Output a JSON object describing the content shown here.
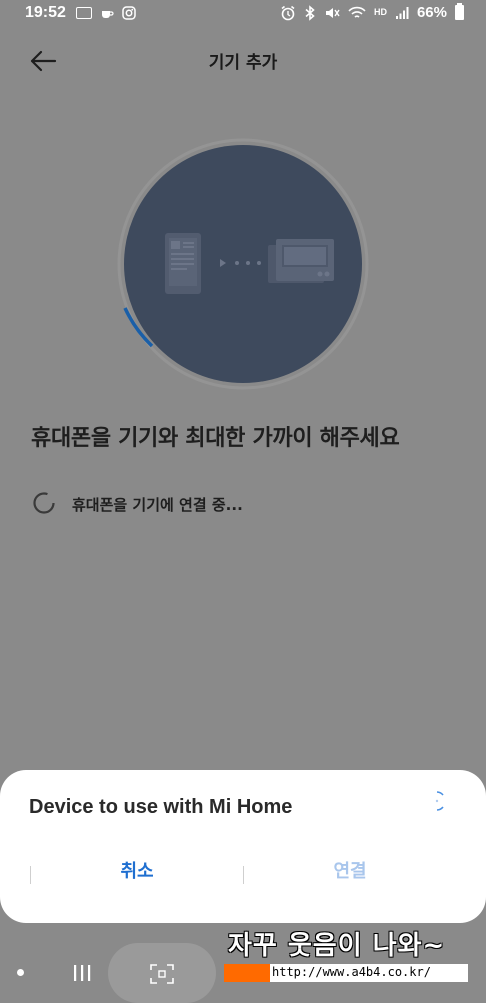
{
  "status_bar": {
    "time": "19:52",
    "battery": "66%",
    "hd_label": "HD"
  },
  "header": {
    "title": "기기 추가",
    "back_icon": "arrow-left-icon"
  },
  "main": {
    "headline": "휴대폰을 기기와 최대한 가까이 해주세요",
    "progress_text": "휴대폰을 기기에 연결 중..."
  },
  "dialog": {
    "title": "Device to use with Mi Home",
    "cancel_label": "취소",
    "connect_label": "연결",
    "colors": {
      "cancel": "#1f6fd0",
      "connect_disabled": "#a9c6ec"
    }
  },
  "watermark": {
    "text": "자꾸 웃음이 나와~",
    "url": "http://www.a4b4.co.kr/"
  },
  "colors": {
    "overlay": "#8a8a8a",
    "circle": "#3e4a5d",
    "progress_arc": "#1a5fa8"
  }
}
